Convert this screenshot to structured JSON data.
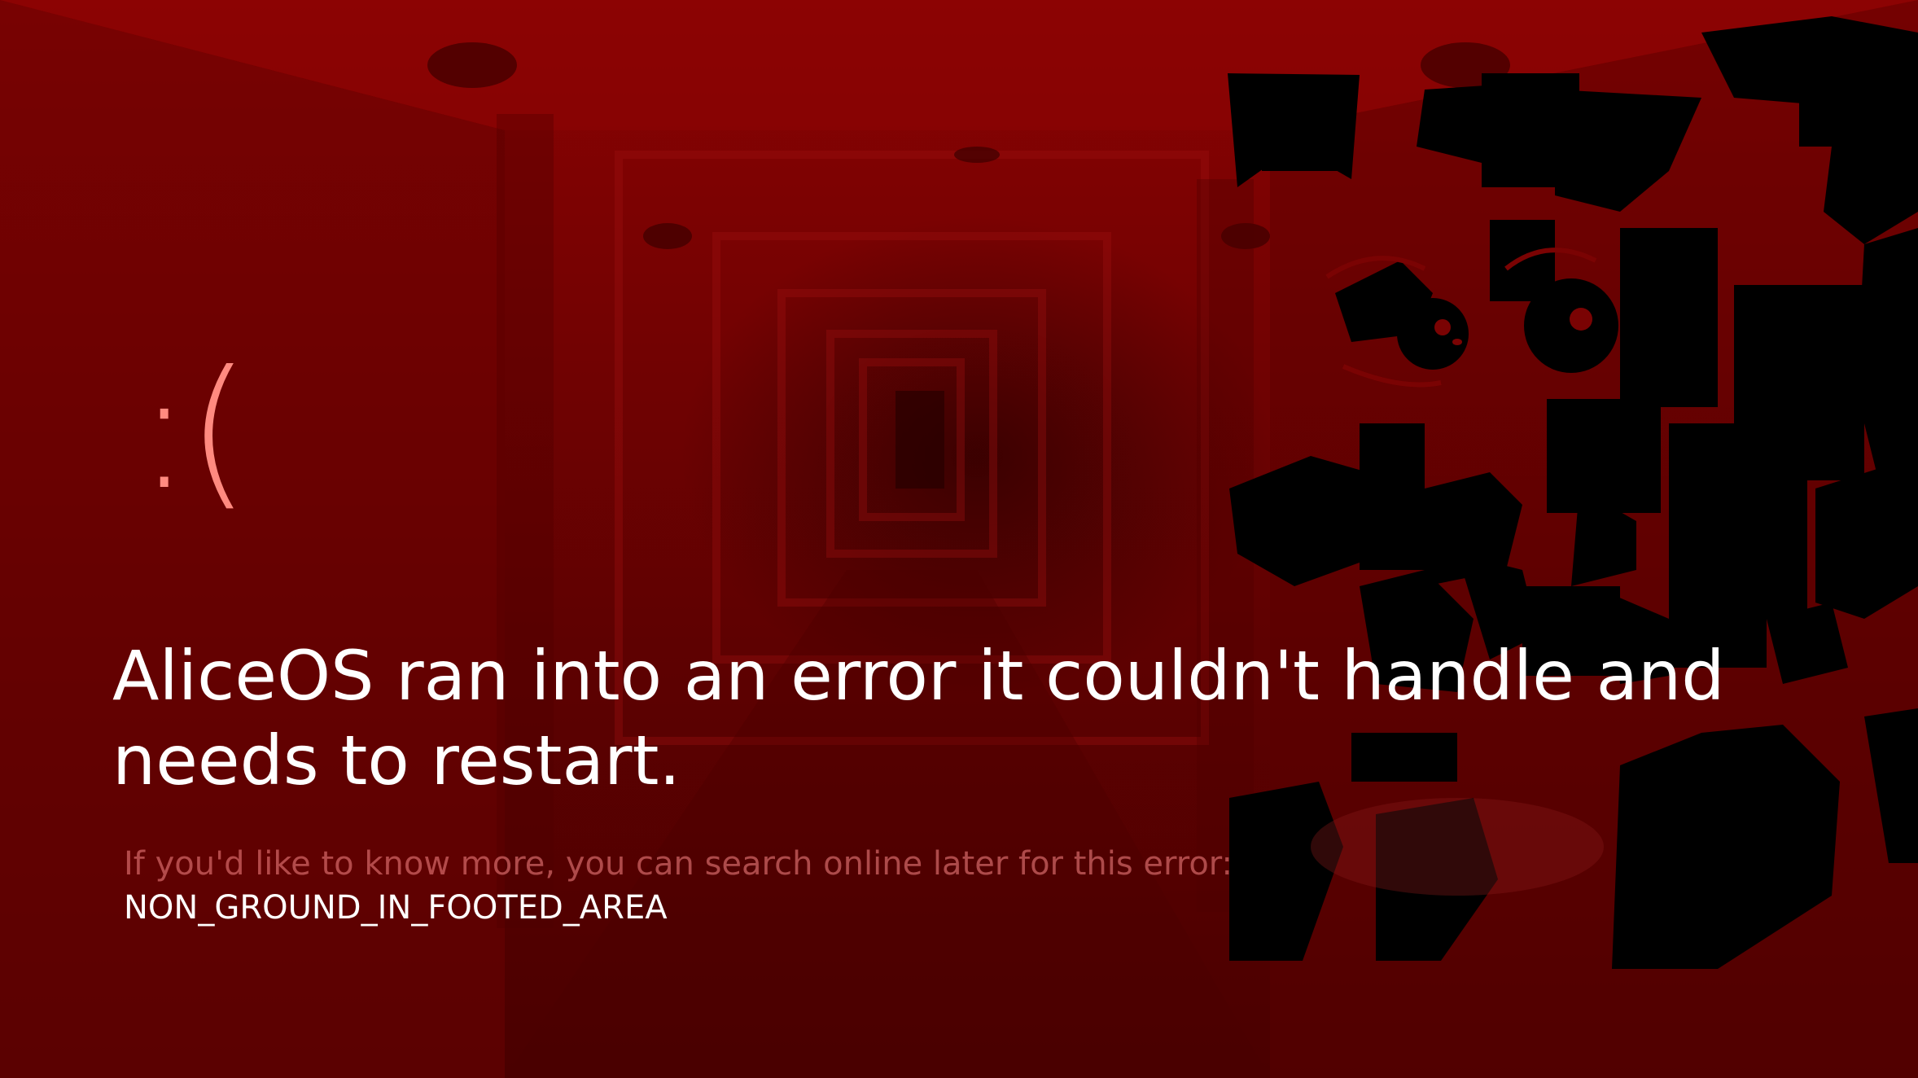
{
  "error_screen": {
    "sad_face": ":(",
    "headline": "AliceOS ran into an error it couldn't handle and needs to restart.",
    "hint": "If you'd like to know more, you can search online later for this error:",
    "error_code": "NON_GROUND_IN_FOOTED_AREA"
  },
  "colors": {
    "background": "#740202",
    "sad_face": "#ff8a80",
    "headline": "#ffffff",
    "hint": "#e67878",
    "error_code": "#ffffff"
  },
  "icons": {
    "background_image": "red-hallway-image",
    "character_art": "glitched-character-silhouette"
  }
}
